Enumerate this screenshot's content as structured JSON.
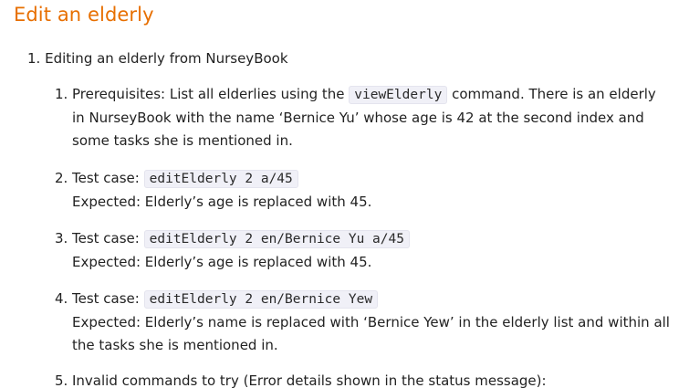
{
  "heading": "Edit an elderly",
  "outer": {
    "number": "1.",
    "text": "Editing an elderly from NurseyBook"
  },
  "items": [
    {
      "number": "1.",
      "prefix": "Prerequisites: List all elderlies using the",
      "code": "viewElderly",
      "suffix": "command. There is an elderly",
      "line2": "in NurseyBook with the name ‘Bernice Yu’ whose age is 42 at the second index and",
      "line3": "some tasks she is mentioned in."
    },
    {
      "number": "2.",
      "prefix": "Test case:",
      "code": "editElderly 2 a/45",
      "line2": "Expected: Elderly’s age is replaced with 45."
    },
    {
      "number": "3.",
      "prefix": "Test case:",
      "code": "editElderly 2 en/Bernice Yu a/45",
      "line2": "Expected: Elderly’s age is replaced with 45."
    },
    {
      "number": "4.",
      "prefix": "Test case:",
      "code": "editElderly 2 en/Bernice Yew",
      "line2": "Expected: Elderly’s name is replaced with ‘Bernice Yew’ in the elderly list and within all",
      "line3": "the tasks she is mentioned in."
    },
    {
      "number": "5.",
      "prefix": "Invalid commands to try (Error details shown in the status message):"
    }
  ]
}
